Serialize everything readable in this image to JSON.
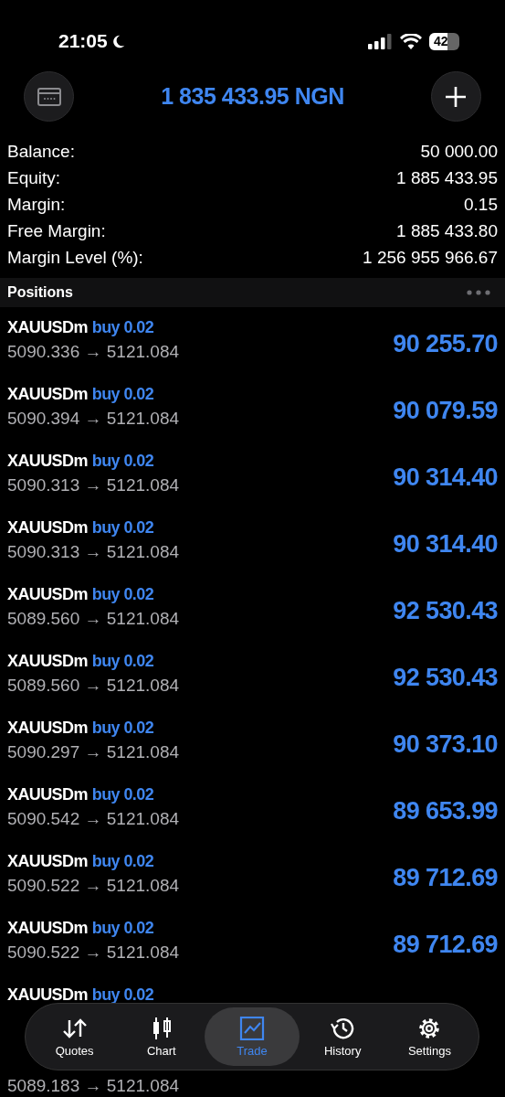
{
  "status_bar": {
    "time": "21:05",
    "battery": "42"
  },
  "header": {
    "title": "1 835 433.95 NGN"
  },
  "summary": [
    {
      "label": "Balance:",
      "value": "50 000.00"
    },
    {
      "label": "Equity:",
      "value": "1 885 433.95"
    },
    {
      "label": "Margin:",
      "value": "0.15"
    },
    {
      "label": "Free Margin:",
      "value": "1 885 433.80"
    },
    {
      "label": "Margin Level (%):",
      "value": "1 256 955 966.67"
    }
  ],
  "positions": {
    "title": "Positions",
    "rows": [
      {
        "symbol": "XAUUSDm",
        "side": "buy 0.02",
        "prices": "5090.336 → 5121.084",
        "profit": "90 255.70"
      },
      {
        "symbol": "XAUUSDm",
        "side": "buy 0.02",
        "prices": "5090.394 → 5121.084",
        "profit": "90 079.59"
      },
      {
        "symbol": "XAUUSDm",
        "side": "buy 0.02",
        "prices": "5090.313 → 5121.084",
        "profit": "90 314.40"
      },
      {
        "symbol": "XAUUSDm",
        "side": "buy 0.02",
        "prices": "5090.313 → 5121.084",
        "profit": "90 314.40"
      },
      {
        "symbol": "XAUUSDm",
        "side": "buy 0.02",
        "prices": "5089.560 → 5121.084",
        "profit": "92 530.43"
      },
      {
        "symbol": "XAUUSDm",
        "side": "buy 0.02",
        "prices": "5089.560 → 5121.084",
        "profit": "92 530.43"
      },
      {
        "symbol": "XAUUSDm",
        "side": "buy 0.02",
        "prices": "5090.297 → 5121.084",
        "profit": "90 373.10"
      },
      {
        "symbol": "XAUUSDm",
        "side": "buy 0.02",
        "prices": "5090.542 → 5121.084",
        "profit": "89 653.99"
      },
      {
        "symbol": "XAUUSDm",
        "side": "buy 0.02",
        "prices": "5090.522 → 5121.084",
        "profit": "89 712.69"
      },
      {
        "symbol": "XAUUSDm",
        "side": "buy 0.02",
        "prices": "5090.522 → 5121.084",
        "profit": "89 712.69"
      },
      {
        "symbol": "XAUUSDm",
        "side": "buy 0.02"
      },
      {
        "prices": "5089.183 → 5121.084"
      }
    ]
  },
  "tab_bar": [
    {
      "label": "Quotes",
      "kind": "quotes",
      "selected": false
    },
    {
      "label": "Chart",
      "kind": "chart",
      "selected": false
    },
    {
      "label": "Trade",
      "kind": "trade",
      "selected": true
    },
    {
      "label": "History",
      "kind": "history",
      "selected": false
    },
    {
      "label": "Settings",
      "kind": "settings",
      "selected": false
    }
  ]
}
